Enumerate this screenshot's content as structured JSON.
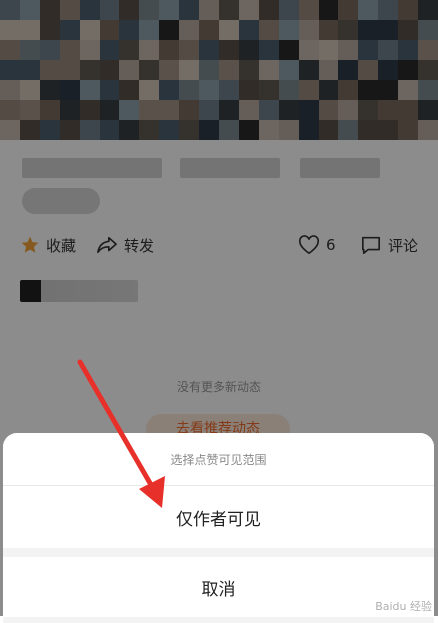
{
  "post": {
    "actions": {
      "favorite_label": "收藏",
      "forward_label": "转发",
      "like_count": "6",
      "comment_label": "评论"
    },
    "no_more_text": "没有更多新动态",
    "recommend_pill_label": "去看推荐动态"
  },
  "sheet": {
    "title": "选择点赞可见范围",
    "option_only_author": "仅作者可见",
    "cancel_label": "取消"
  },
  "colors": {
    "accent_orange": "#f06a2c",
    "star_yellow": "#f3a33a",
    "annotation_red": "#e8302a"
  },
  "icons": [
    "star-icon",
    "forward-icon",
    "heart-icon",
    "comment-icon"
  ]
}
